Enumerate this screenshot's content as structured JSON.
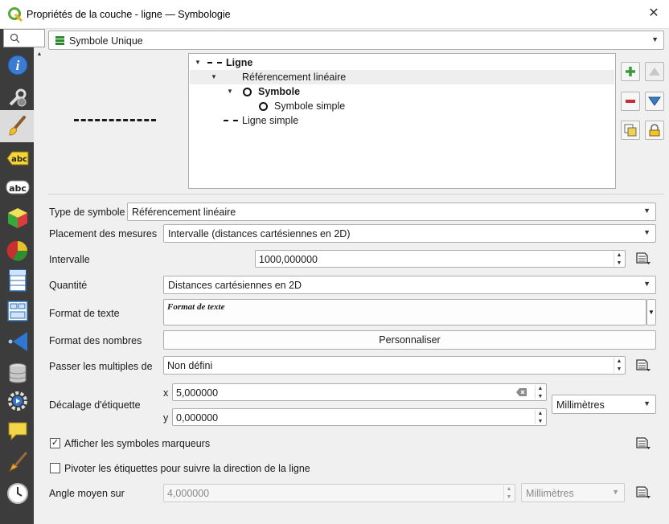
{
  "window": {
    "title": "Propriétés de la couche - ligne — Symbologie"
  },
  "sidebar": {
    "search_icon": "search-icon",
    "items": [
      {
        "name": "information",
        "icon": "info-icon"
      },
      {
        "name": "source",
        "icon": "wrench-icon"
      },
      {
        "name": "symbology",
        "icon": "paintbrush-icon",
        "active": true
      },
      {
        "name": "labels",
        "icon": "abc-label-icon"
      },
      {
        "name": "masks",
        "icon": "abc-mask-icon"
      },
      {
        "name": "3d-view",
        "icon": "cube-icon"
      },
      {
        "name": "diagrams",
        "icon": "diagram-icon"
      },
      {
        "name": "fields",
        "icon": "fields-icon"
      },
      {
        "name": "attributes-form",
        "icon": "form-icon"
      },
      {
        "name": "joins",
        "icon": "join-icon"
      },
      {
        "name": "auxiliary-storage",
        "icon": "database-icon"
      },
      {
        "name": "actions",
        "icon": "gear-play-icon"
      },
      {
        "name": "display",
        "icon": "speech-bubble-icon"
      },
      {
        "name": "rendering",
        "icon": "brush-icon"
      },
      {
        "name": "temporal",
        "icon": "clock-icon"
      }
    ]
  },
  "renderer": {
    "value": "Symbole Unique"
  },
  "tree": {
    "rows": [
      {
        "label": "Ligne",
        "bold": true
      },
      {
        "label": "Référencement linéaire",
        "bold": false
      },
      {
        "label": "Symbole",
        "bold": true
      },
      {
        "label": "Symbole simple",
        "bold": false
      },
      {
        "label": "Ligne simple",
        "bold": false
      }
    ]
  },
  "form": {
    "symbol_type": {
      "label": "Type de symbole",
      "value": "Référencement linéaire"
    },
    "placement": {
      "label": "Placement des mesures",
      "value": "Intervalle (distances cartésiennes en 2D)"
    },
    "interval": {
      "label": "Intervalle",
      "value": "1000,000000"
    },
    "quantity": {
      "label": "Quantité",
      "value": "Distances cartésiennes en 2D"
    },
    "text_format": {
      "label": "Format de texte",
      "value": "Format de texte"
    },
    "number_format": {
      "label": "Format des nombres",
      "button": "Personnaliser"
    },
    "skip_multiples": {
      "label": "Passer les multiples de",
      "value": "Non défini"
    },
    "label_offset": {
      "label": "Décalage d'étiquette",
      "x_label": "x",
      "x_value": "5,000000",
      "y_label": "y",
      "y_value": "0,000000",
      "unit": "Millimètres"
    },
    "show_markers": {
      "label": "Afficher les symboles marqueurs",
      "checked": true
    },
    "rotate_labels": {
      "label": "Pivoter les étiquettes pour suivre la direction de la ligne",
      "checked": false
    },
    "average_angle": {
      "label": "Angle moyen sur",
      "value": "4,000000",
      "unit": "Millimètres"
    }
  },
  "colors": {
    "sidebar_bg": "#3c3c3c",
    "tree_selected": "#eeeeee",
    "add_green": "#3a9a3a",
    "remove_red": "#c43030",
    "arrow_blue": "#3b7bbf"
  }
}
